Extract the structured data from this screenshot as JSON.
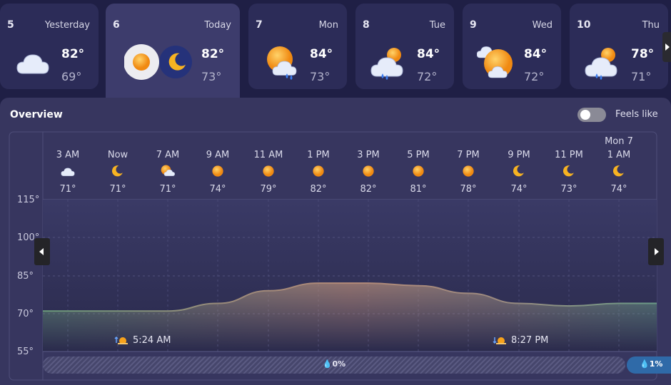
{
  "days": [
    {
      "num": "5",
      "label": "Yesterday",
      "high": "82°",
      "low": "69°",
      "icon": "cloudy-icon"
    },
    {
      "num": "6",
      "label": "Today",
      "high": "82°",
      "low": "73°",
      "icon": "sun-moon-icon"
    },
    {
      "num": "7",
      "label": "Mon",
      "high": "84°",
      "low": "73°",
      "icon": "sun-cloud-rain-icon"
    },
    {
      "num": "8",
      "label": "Tue",
      "high": "84°",
      "low": "72°",
      "icon": "cloud-rain-sun-icon"
    },
    {
      "num": "9",
      "label": "Wed",
      "high": "84°",
      "low": "72°",
      "icon": "partly-sunny-icon"
    },
    {
      "num": "10",
      "label": "Thu",
      "high": "78°",
      "low": "71°",
      "icon": "cloud-rain-sun-icon"
    }
  ],
  "overview": {
    "title": "Overview",
    "feels_like_label": "Feels like",
    "feels_like_on": false
  },
  "hours": [
    {
      "date": "",
      "time": "3 AM",
      "temp": "71°",
      "icon": "cloud-icon"
    },
    {
      "date": "",
      "time": "Now",
      "temp": "71°",
      "icon": "moon-icon"
    },
    {
      "date": "",
      "time": "7 AM",
      "temp": "71°",
      "icon": "sun-cloud-icon"
    },
    {
      "date": "",
      "time": "9 AM",
      "temp": "74°",
      "icon": "sun-icon"
    },
    {
      "date": "",
      "time": "11 AM",
      "temp": "79°",
      "icon": "sun-icon"
    },
    {
      "date": "",
      "time": "1 PM",
      "temp": "82°",
      "icon": "sun-icon"
    },
    {
      "date": "",
      "time": "3 PM",
      "temp": "82°",
      "icon": "sun-icon"
    },
    {
      "date": "",
      "time": "5 PM",
      "temp": "81°",
      "icon": "sun-icon"
    },
    {
      "date": "",
      "time": "7 PM",
      "temp": "78°",
      "icon": "sun-icon"
    },
    {
      "date": "",
      "time": "9 PM",
      "temp": "74°",
      "icon": "moon-icon"
    },
    {
      "date": "",
      "time": "11 PM",
      "temp": "73°",
      "icon": "moon-icon"
    },
    {
      "date": "Mon 7",
      "time": "1 AM",
      "temp": "74°",
      "icon": "moon-icon"
    }
  ],
  "chart_data": {
    "type": "area",
    "yticks": [
      "115°",
      "100°",
      "85°",
      "70°",
      "55°"
    ],
    "ylim": [
      55,
      115
    ],
    "x": [
      "3 AM",
      "Now",
      "7 AM",
      "9 AM",
      "11 AM",
      "1 PM",
      "3 PM",
      "5 PM",
      "7 PM",
      "9 PM",
      "11 PM",
      "1 AM"
    ],
    "values": [
      71,
      71,
      71,
      74,
      79,
      82,
      82,
      81,
      78,
      74,
      73,
      74
    ]
  },
  "sun_events": {
    "sunrise": "5:24 AM",
    "sunset": "8:27 PM"
  },
  "precip": {
    "today": "0%",
    "next": "1%"
  },
  "colors": {
    "background": "#1f1f45",
    "card": "#2c2c58",
    "card_active": "#3d3c6c",
    "panel": "#37365f",
    "precip_blue": "#2f6aa8"
  }
}
